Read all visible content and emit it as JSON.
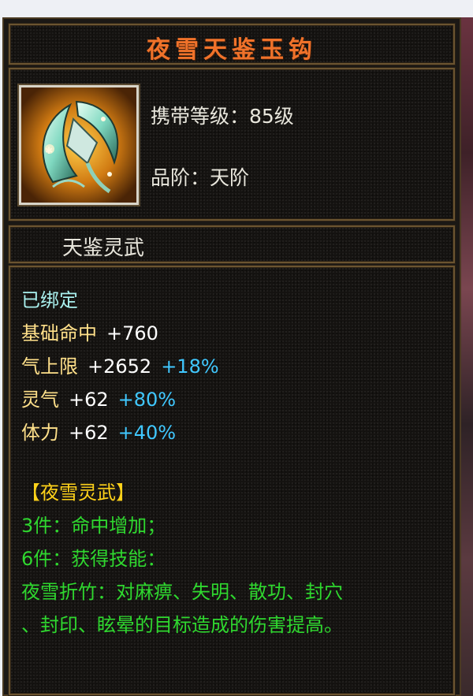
{
  "item": {
    "title": "夜雪天鉴玉钩",
    "carry_level_label": "携带等级：85级",
    "grade_label": "品阶：天阶",
    "category": "天鉴灵武",
    "icon": "jade-hook-weapon-icon"
  },
  "stats": {
    "bound": "已绑定",
    "hit": {
      "name": "基础命中",
      "value": "+760"
    },
    "qi": {
      "name": "气上限",
      "value": "+2652",
      "pct": "+18%"
    },
    "lingqi": {
      "name": "灵气",
      "value": "+62",
      "pct": "+80%"
    },
    "tili": {
      "name": "体力",
      "value": "+62",
      "pct": "+40%"
    }
  },
  "set": {
    "name": "【夜雪灵武】",
    "bonus3": "3件：命中增加；",
    "bonus6": "6件：获得技能：",
    "skill_line1": "夜雪折竹：对麻痹、失明、散功、封穴",
    "skill_line2": "、封印、眩晕的目标造成的伤害提高。"
  },
  "colors": {
    "title": "#f0722a",
    "stat": "#ffe08a",
    "percent": "#40c8ff",
    "bound": "#a9f0ee",
    "set_name": "#ffd21a",
    "set_effect": "#2fd82f"
  }
}
